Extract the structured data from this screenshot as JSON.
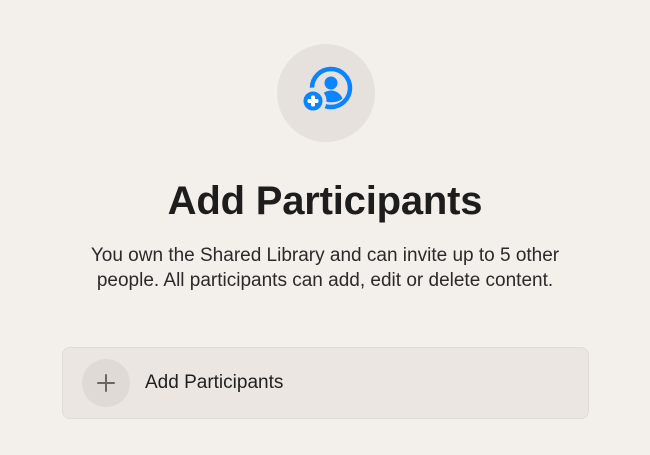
{
  "icons": {
    "hero": "person-add-icon",
    "action": "plus-icon"
  },
  "colors": {
    "accent": "#0a84ff",
    "background": "#f3efeb"
  },
  "header": {
    "title": "Add Participants",
    "description_line_1": "You own the Shared Library and can invite up to 5 other",
    "description_line_2": "people. All participants can add, edit or delete content."
  },
  "action": {
    "label": "Add Participants"
  }
}
